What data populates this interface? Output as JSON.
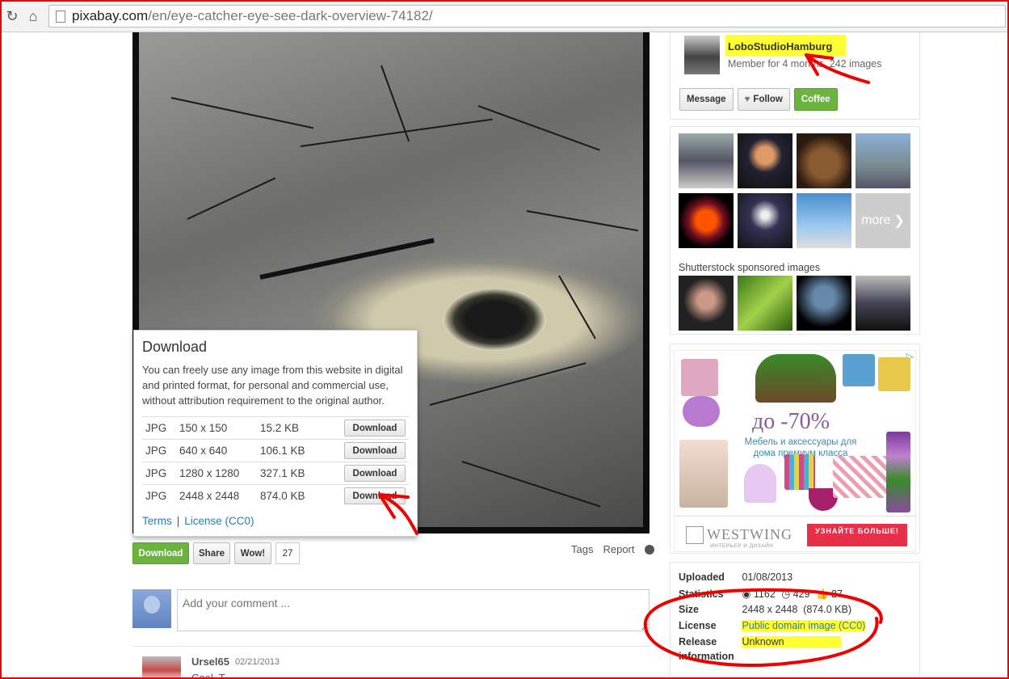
{
  "browser": {
    "url_host": "pixabay.com",
    "url_path": "/en/eye-catcher-eye-see-dark-overview-74182/"
  },
  "download_popup": {
    "title": "Download",
    "text": "You can freely use any image from this website in digital and printed format, for personal and commercial use, without attribution requirement to the original author.",
    "rows": [
      {
        "format": "JPG",
        "dimensions": "150 x 150",
        "size": "15.2 KB",
        "button": "Download"
      },
      {
        "format": "JPG",
        "dimensions": "640 x 640",
        "size": "106.1 KB",
        "button": "Download"
      },
      {
        "format": "JPG",
        "dimensions": "1280 x 1280",
        "size": "327.1 KB",
        "button": "Download"
      },
      {
        "format": "JPG",
        "dimensions": "2448 x 2448",
        "size": "874.0 KB",
        "button": "Download"
      }
    ],
    "terms_link": "Terms",
    "separator": "|",
    "license_link": "License (CC0)"
  },
  "actions": {
    "download": "Download",
    "share": "Share",
    "wow": "Wow!",
    "wow_count": "27",
    "tags": "Tags",
    "report": "Report"
  },
  "comment": {
    "placeholder": "Add your comment ...",
    "first": {
      "user": "Ursel65",
      "date": "02/21/2013",
      "text": "Cool, T..."
    }
  },
  "user": {
    "name": "LoboStudioHamburg",
    "meta": "Member for 4 months, 242 images",
    "buttons": {
      "message": "Message",
      "follow": "Follow",
      "coffee": "Coffee"
    }
  },
  "gallery": {
    "more": "more",
    "sponsored_label": "Shutterstock sponsored images"
  },
  "ad": {
    "discount": "до -70%",
    "description": "Мебель и аксессуары для дома премиум класса",
    "brand": "WESTWING",
    "brand_sub": "ИНТЕРЬЕР И ДИЗАЙН",
    "cta": "УЗНАЙТЕ БОЛЬШЕ!"
  },
  "info": {
    "uploaded_label": "Uploaded",
    "uploaded": "01/08/2013",
    "statistics_label": "Statistics",
    "views": "1162",
    "downloads": "429",
    "likes": "27",
    "size_label": "Size",
    "size": "2448 x 2448  (874.0 KB)",
    "license_label": "License",
    "license": "Public domain image (CC0)",
    "release_label": "Release",
    "release_label2": "information",
    "release": "Unknown"
  },
  "colors": {
    "accent_green": "#6cb33f",
    "link_blue": "#2a7ab0",
    "highlight_yellow": "#ffff33",
    "annotation_red": "#e00000"
  }
}
